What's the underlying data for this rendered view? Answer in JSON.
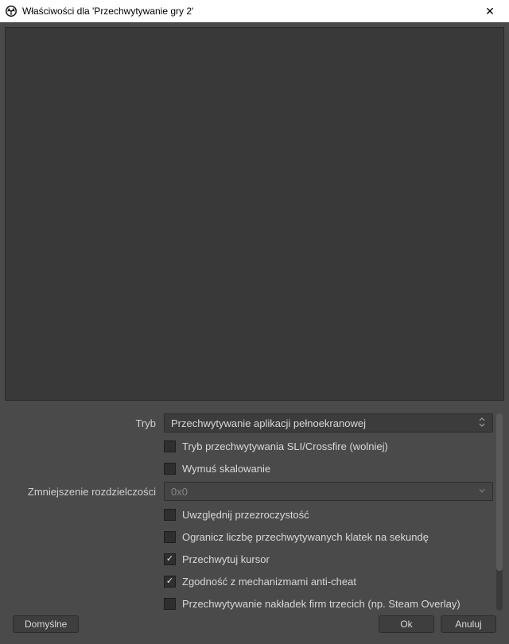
{
  "window": {
    "title": "Właściwości dla 'Przechwytywanie gry 2'"
  },
  "form": {
    "mode_label": "Tryb",
    "mode_value": "Przechwytywanie aplikacji pełnoekranowej",
    "sli_label": "Tryb przechwytywania SLI/Crossfire (wolniej)",
    "sli_checked": false,
    "force_scale_label": "Wymuś skalowanie",
    "force_scale_checked": false,
    "resolution_label": "Zmniejszenie rozdzielczości",
    "resolution_value": "0x0",
    "transparency_label": "Uwzględnij przezroczystość",
    "transparency_checked": false,
    "limit_fps_label": "Ogranicz liczbę przechwytywanych klatek na sekundę",
    "limit_fps_checked": false,
    "capture_cursor_label": "Przechwytuj kursor",
    "capture_cursor_checked": true,
    "anticheat_label": "Zgodność z mechanizmami anti-cheat",
    "anticheat_checked": true,
    "overlay_label": "Przechwytywanie nakładek firm trzecich (np. Steam Overlay)",
    "overlay_checked": false
  },
  "buttons": {
    "defaults": "Domyślne",
    "ok": "Ok",
    "cancel": "Anuluj"
  }
}
